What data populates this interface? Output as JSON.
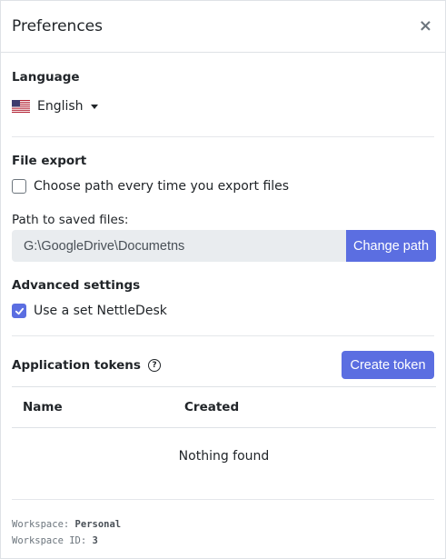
{
  "dialog": {
    "title": "Preferences",
    "close_glyph": "×"
  },
  "language": {
    "section_title": "Language",
    "selected": "English",
    "flag_icon": "us-flag-icon"
  },
  "file_export": {
    "section_title": "File export",
    "choose_path_label": "Choose path every time you export files",
    "choose_path_checked": false,
    "path_label": "Path to saved files:",
    "path_value": "G:\\GoogleDrive\\Documetns",
    "change_path_label": "Change path"
  },
  "advanced": {
    "section_title": "Advanced settings",
    "nettledesk_label": "Use a set NettleDesk",
    "nettledesk_checked": true
  },
  "tokens": {
    "section_title": "Application tokens",
    "help_glyph": "?",
    "create_label": "Create token",
    "columns": [
      "Name",
      "Created"
    ],
    "empty_text": "Nothing found"
  },
  "footer": {
    "workspace_label": "Workspace:",
    "workspace_value": "Personal",
    "workspace_id_label": "Workspace ID:",
    "workspace_id_value": "3"
  },
  "colors": {
    "accent": "#5b6ee1",
    "input_bg": "#e9ecef",
    "divider": "#dee2e6"
  }
}
